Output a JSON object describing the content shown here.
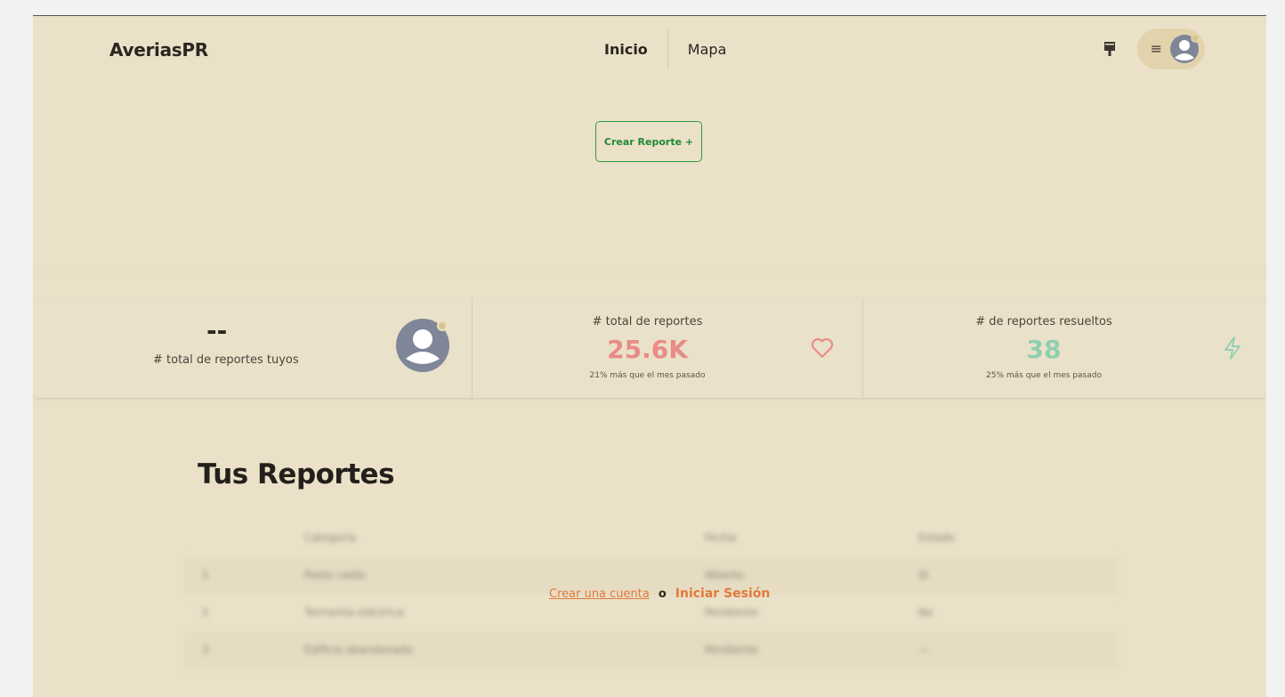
{
  "header": {
    "brand": "AveriasPR",
    "nav": [
      {
        "label": "Inicio",
        "active": true
      },
      {
        "label": "Mapa",
        "active": false
      }
    ],
    "icons": {
      "theme": "paint-brush-icon",
      "menu": "hamburger-icon",
      "user": "user-avatar-icon"
    }
  },
  "actions": {
    "create_report": "Crear Reporte +"
  },
  "stats": {
    "mine": {
      "value": "--",
      "label": "# total de reportes tuyos"
    },
    "total": {
      "label": "# total de reportes",
      "value": "25.6K",
      "sub": "21% más que el mes pasado",
      "icon": "heart-icon"
    },
    "resolved": {
      "label": "# de reportes resueltos",
      "value": "38",
      "sub": "25% más que el mes pasado",
      "icon": "lightning-icon"
    }
  },
  "reports": {
    "title": "Tus Reportes",
    "columns": [
      "Categoría",
      "Fecha",
      "Estado"
    ],
    "rows": [
      [
        "1",
        "Poste caído",
        "Abierto",
        "Sí"
      ],
      [
        "2",
        "Tormenta eléctrica",
        "Pendiente",
        "No"
      ],
      [
        "3",
        "Edificio abandonado",
        "Pendiente",
        "—"
      ]
    ]
  },
  "auth": {
    "signup": "Crear una cuenta",
    "or": "o",
    "login": "Iniciar Sesión"
  },
  "colors": {
    "background": "#ebe1c9",
    "accent_green": "#2e9a3f",
    "total_value": "#e98b86",
    "resolved_value": "#8fcfb0",
    "auth_link": "#e07a3a"
  }
}
